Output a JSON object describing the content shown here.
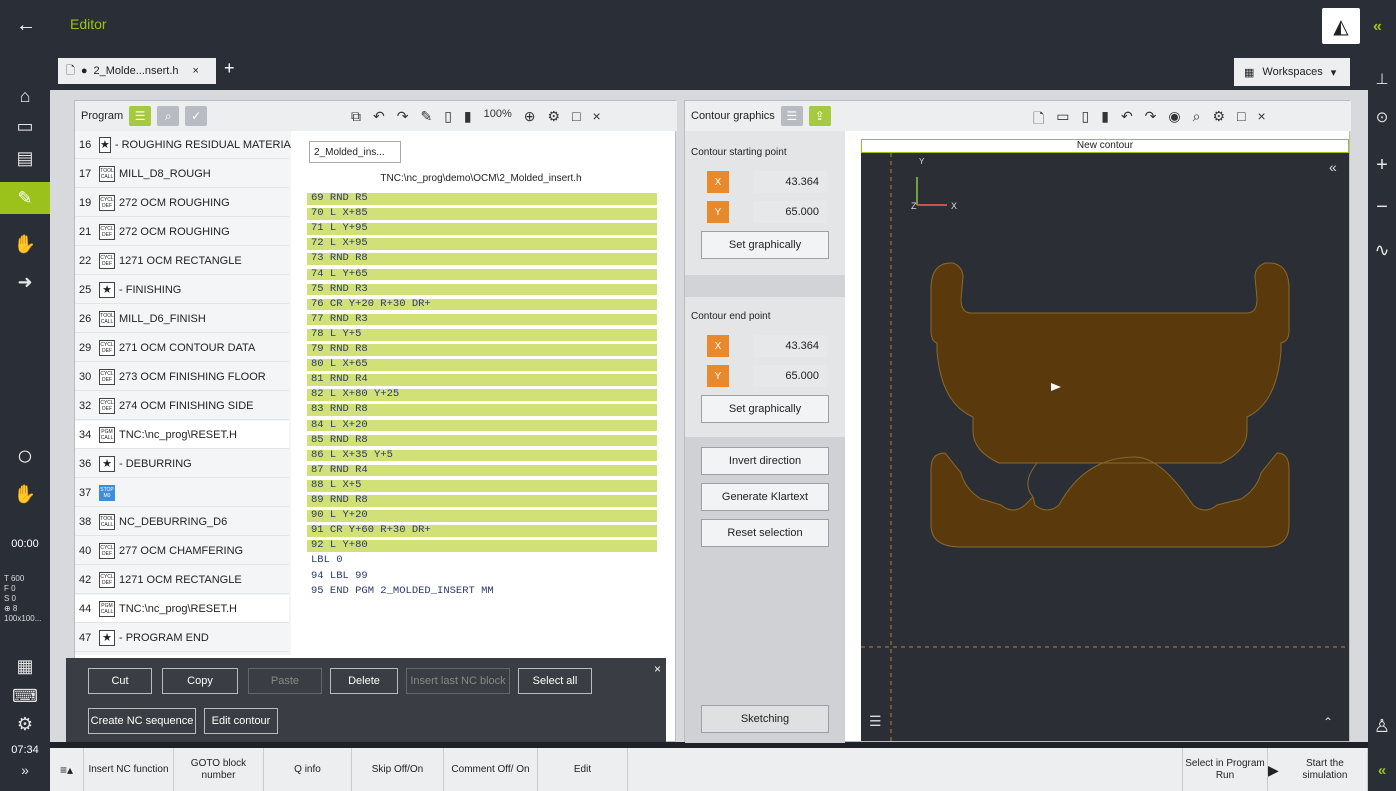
{
  "titlebar": {
    "title": "Editor"
  },
  "tab": {
    "name": "2_Molde...nsert.h"
  },
  "workspaces": {
    "label": "Workspaces"
  },
  "program_panel": {
    "title": "Program",
    "rows": [
      {
        "num": "16",
        "badge": "★",
        "type": "star",
        "text": "- ROUGHING RESIDUAL MATERIAL"
      },
      {
        "num": "17",
        "badge": "TOOL CALL",
        "type": "cmd",
        "text": "MILL_D8_ROUGH"
      },
      {
        "num": "19",
        "badge": "CYCL DEF",
        "type": "cmd",
        "text": "272 OCM ROUGHING"
      },
      {
        "num": "21",
        "badge": "CYCL DEF",
        "type": "cmd",
        "text": "272 OCM ROUGHING"
      },
      {
        "num": "22",
        "badge": "CYCL DEF",
        "type": "cmd",
        "text": "1271 OCM RECTANGLE"
      },
      {
        "num": "25",
        "badge": "★",
        "type": "star",
        "text": "- FINISHING"
      },
      {
        "num": "26",
        "badge": "TOOL CALL",
        "type": "cmd",
        "text": "MILL_D6_FINISH"
      },
      {
        "num": "29",
        "badge": "CYCL DEF",
        "type": "cmd",
        "text": "271 OCM CONTOUR DATA"
      },
      {
        "num": "30",
        "badge": "CYCL DEF",
        "type": "cmd",
        "text": "273 OCM FINISHING FLOOR"
      },
      {
        "num": "32",
        "badge": "CYCL DEF",
        "type": "cmd",
        "text": "274 OCM FINISHING SIDE"
      },
      {
        "num": "34",
        "badge": "PGM CALL",
        "type": "cmd",
        "text": "TNC:\\nc_prog\\RESET.H"
      },
      {
        "num": "36",
        "badge": "★",
        "type": "star",
        "text": "- DEBURRING"
      },
      {
        "num": "37",
        "badge": "STOP M0",
        "type": "stop",
        "text": ""
      },
      {
        "num": "38",
        "badge": "TOOL CALL",
        "type": "cmd",
        "text": "NC_DEBURRING_D6"
      },
      {
        "num": "40",
        "badge": "CYCL DEF",
        "type": "cmd",
        "text": "277 OCM CHAMFERING"
      },
      {
        "num": "42",
        "badge": "CYCL DEF",
        "type": "cmd",
        "text": "1271 OCM RECTANGLE"
      },
      {
        "num": "44",
        "badge": "PGM CALL",
        "type": "cmd",
        "text": "TNC:\\nc_prog\\RESET.H"
      },
      {
        "num": "47",
        "badge": "★",
        "type": "star",
        "text": "- PROGRAM END"
      }
    ]
  },
  "editor": {
    "zoom": "100%",
    "breadcrumb": "2_Molded_ins...",
    "path": "TNC:\\nc_prog\\demo\\OCM\\2_Molded_insert.h",
    "lines": [
      "69 RND R5",
      "70 L X+85",
      "71 L Y+95",
      "72 L X+95",
      "73 RND R8",
      "74 L Y+65",
      "75 RND R3",
      "76 CR Y+20 R+30 DR+",
      "77 RND R3",
      "78 L Y+5",
      "79 RND R8",
      "80 L X+65",
      "81 RND R4",
      "82 L X+80 Y+25",
      "83 RND R8",
      "84 L X+20",
      "85 RND R8",
      "86 L X+35 Y+5",
      "87 RND R4",
      "88 L X+5",
      "89 RND R8",
      "90 L Y+20",
      "91 CR Y+60 R+30 DR+",
      "92 L Y+80",
      "LBL 0",
      "94 LBL 99",
      "95 END PGM 2_MOLDED_INSERT MM"
    ]
  },
  "context_bar": {
    "cut": "Cut",
    "copy": "Copy",
    "paste": "Paste",
    "delete": "Delete",
    "insert_last": "Insert last NC block",
    "select_all": "Select all",
    "create_seq": "Create NC sequence",
    "edit_contour": "Edit contour"
  },
  "contour_panel": {
    "title": "Contour graphics",
    "start_label": "Contour starting point",
    "end_label": "Contour end point",
    "x_label": "X",
    "y_label": "Y",
    "start_x": "43.364",
    "start_y": "65.000",
    "end_x": "43.364",
    "end_y": "65.000",
    "set_graphically": "Set graphically",
    "invert": "Invert direction",
    "generate": "Generate Klartext",
    "reset": "Reset selection",
    "sketching": "Sketching"
  },
  "canvas": {
    "title": "New contour",
    "axis_y": "Y",
    "axis_z": "Z",
    "axis_x": "X",
    "fill_color": "#5a3a0d"
  },
  "left_status": {
    "time": "00:00",
    "clock": "07:34",
    "feed_t": "T 600",
    "feed_f": "F 0",
    "feed_s": "S 0",
    "feed_p": "⊕ 8",
    "feed_z": "100x100..."
  },
  "bottom": {
    "insert_nc": "Insert NC function",
    "goto": "GOTO block number",
    "qinfo": "Q info",
    "skip": "Skip Off/On",
    "comment": "Comment Off/ On",
    "edit": "Edit",
    "select_run": "Select in Program Run",
    "start_sim": "Start the simulation"
  }
}
